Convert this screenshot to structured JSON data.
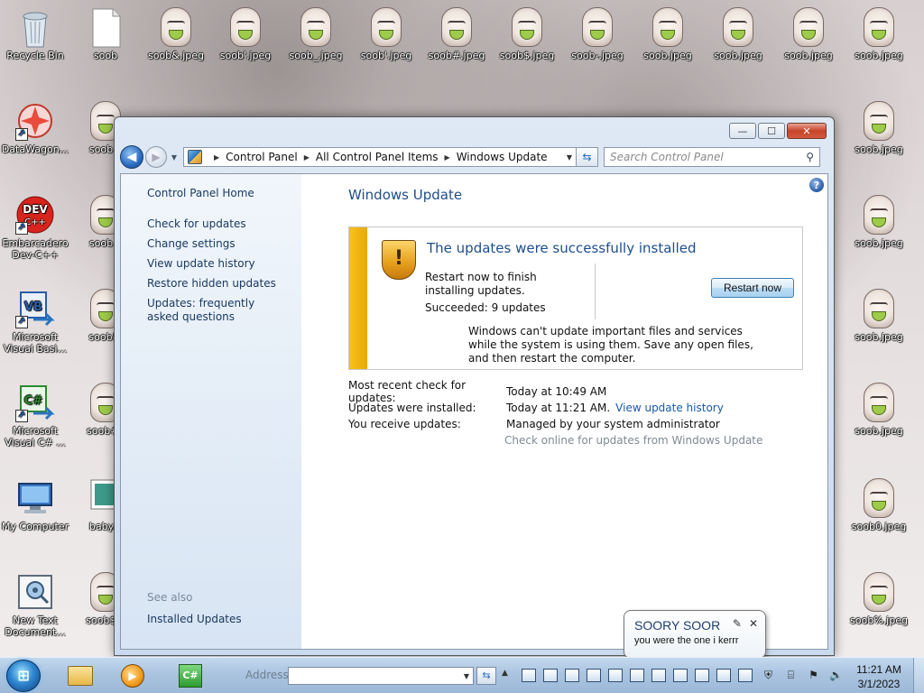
{
  "desktop": {
    "left_icons": [
      {
        "label": "Recycle Bin",
        "icon": "recycle-bin-icon"
      },
      {
        "label": "DataWagon...",
        "icon": "datawagon-icon"
      },
      {
        "label": "Embarcadero Dev-C++",
        "icon": "devcpp-icon"
      },
      {
        "label": "Microsoft Visual Basi...",
        "icon": "visual-basic-icon"
      },
      {
        "label": "Microsoft Visual C# ...",
        "icon": "visual-csharp-icon"
      },
      {
        "label": "My Computer",
        "icon": "computer-icon"
      },
      {
        "label": "New Text Document...",
        "icon": "text-document-icon"
      }
    ],
    "top_row": [
      "soob",
      "soob&.jpeg",
      "soob'.jpeg",
      "soob_.jpeg",
      "soob'.jpeg",
      "soob#.jpeg",
      "soob$.jpeg",
      "soob-.jpeg",
      "soob.jpeg",
      "soob.jpeg",
      "soob.jpeg",
      "soob.jpeg"
    ],
    "column2": [
      "soob .j",
      "soob .j",
      "soob!.j",
      "soob#.j",
      "baby...",
      "soob$..."
    ],
    "right_col": [
      "soob.jpeg",
      "soob.jpeg",
      "soob.jpeg",
      "soob.jpeg",
      "soob0.jpeg",
      "soob%.jpeg"
    ]
  },
  "window": {
    "controls": {
      "minimize": "—",
      "maximize": "☐",
      "close": "✕"
    },
    "nav": {
      "back": "◀",
      "forward": "▶",
      "dropdown": "▼"
    },
    "breadcrumb": [
      "Control Panel",
      "All Control Panel Items",
      "Windows Update"
    ],
    "search_placeholder": "Search Control Panel",
    "left_pane": {
      "home": "Control Panel Home",
      "links": [
        "Check for updates",
        "Change settings",
        "View update history",
        "Restore hidden updates",
        "Updates: frequently asked questions"
      ],
      "see_also": "See also",
      "installed_updates": "Installed Updates"
    },
    "main": {
      "title": "Windows Update",
      "status": {
        "title": "The updates were successfully installed",
        "subtitle": "Restart now to finish installing updates.",
        "succeeded": "Succeeded: 9 updates",
        "restart_button": "Restart now",
        "note": "Windows can't update important files and services while the system is using them. Save any open files, and then restart the computer.",
        "accent_color": "#f6c21a"
      },
      "info": {
        "recent_check_label": "Most recent check for updates:",
        "recent_check_value": "Today at 10:49 AM",
        "installed_label": "Updates were installed:",
        "installed_value": "Today at 11:21 AM.",
        "history_link": "View update history",
        "receive_label": "You receive updates:",
        "receive_value": "Managed by your system administrator",
        "online_link": "Check online for updates from Windows Update"
      }
    }
  },
  "notification": {
    "title": "SOORY SOOR",
    "message": "you were the one i kerrr",
    "close": "✕"
  },
  "taskbar": {
    "address_label": "Address",
    "address_value": "",
    "clock_time": "11:21 AM",
    "clock_date": "3/1/2023"
  }
}
